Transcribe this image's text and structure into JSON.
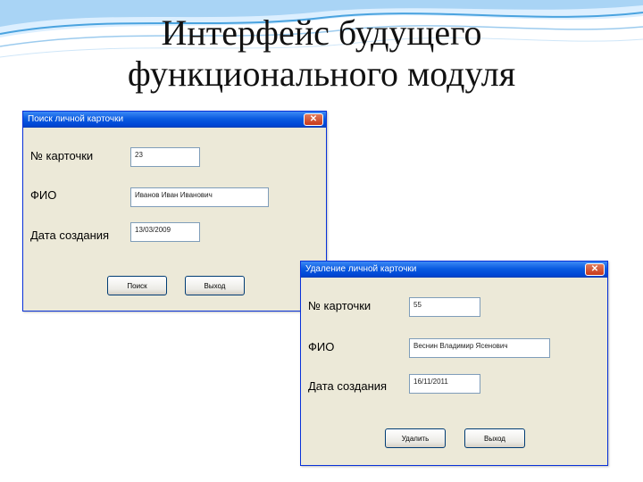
{
  "slide": {
    "title_line1": "Интерфейс будущего",
    "title_line2": "функционального модуля"
  },
  "search_window": {
    "title": "Поиск личной карточки",
    "close_glyph": "✕",
    "card_number_label": "№ карточки",
    "card_number_value": "23",
    "fio_label": "ФИО",
    "fio_value": "Иванов Иван Иванович",
    "created_label": "Дата создания",
    "created_value": "13/03/2009",
    "search_button": "Поиск",
    "exit_button": "Выход"
  },
  "delete_window": {
    "title": "Удаление личной карточки",
    "close_glyph": "✕",
    "card_number_label": "№ карточки",
    "card_number_value": "55",
    "fio_label": "ФИО",
    "fio_value": "Веснин Владимир Ясенович",
    "created_label": "Дата создания",
    "created_value": "16/11/2011",
    "delete_button": "Удалить",
    "exit_button": "Выход"
  },
  "colors": {
    "window_face": "#ece9d8",
    "titlebar": "#0a5be0",
    "close_button": "#c8391b",
    "decor_wave": "#4aa3df"
  }
}
